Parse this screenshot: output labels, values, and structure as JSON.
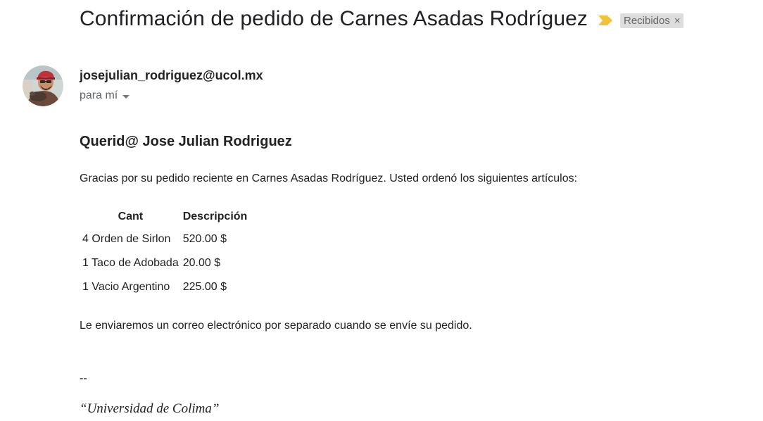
{
  "email": {
    "subject": "Confirmación de pedido de Carnes Asadas Rodríguez",
    "label": "Recibidos",
    "label_close": "×",
    "importance_icon": "importance-marker-icon",
    "sender": "josejulian_rodriguez@ucol.mx",
    "recipient_text": "para mí",
    "colors": {
      "importance": "#f2c23a",
      "label_bg": "#dddddd"
    }
  },
  "body": {
    "greeting": "Querid@ Jose Julian Rodriguez",
    "intro": "Gracias por su pedido reciente en Carnes Asadas Rodríguez. Usted ordenó los siguientes artículos:",
    "table": {
      "headers": [
        "Cant",
        "Descripción"
      ],
      "rows": [
        {
          "item": "4 Orden de Sirlon",
          "price": "520.00 $"
        },
        {
          "item": "1 Taco de Adobada",
          "price": "20.00 $"
        },
        {
          "item": "1 Vacio Argentino",
          "price": "225.00 $"
        }
      ]
    },
    "outro": "Le enviaremos un correo electrónico por separado cuando se envíe su pedido.",
    "signature_separator": "--",
    "signature": "“Universidad de Colima”"
  }
}
